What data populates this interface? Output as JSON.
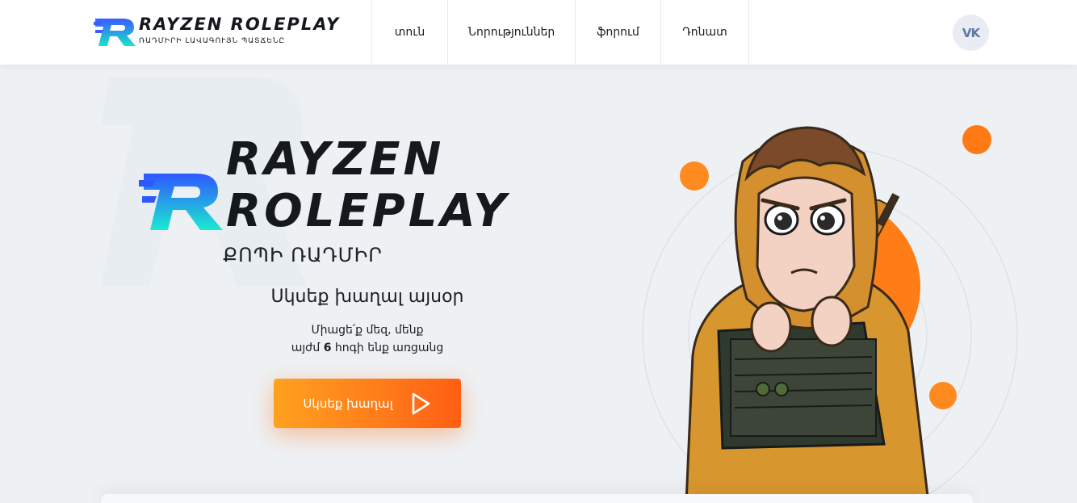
{
  "header": {
    "logo": {
      "title": "RAYZEN ROLEPLAY",
      "subtitle": "ՌԱԴՄԻՐԻ ԼԱՎԱԳՈՒՅՆ ՊԱՏՃԵՆԸ",
      "colors": {
        "gradient_start": "#3b5bff",
        "gradient_end": "#19e3c8"
      }
    },
    "nav": [
      {
        "label": "տուն"
      },
      {
        "label": "Նորություններ"
      },
      {
        "label": "ֆորում"
      },
      {
        "label": "Դոնատ"
      }
    ],
    "social": {
      "label": "VK",
      "icon": "vk-icon"
    }
  },
  "hero": {
    "title_line1": "RAYZEN",
    "title_line2": "ROLEPLAY",
    "subtitle": "ՔՈՊԻ ՌԱԴՄԻՐ",
    "lead": "Սկսեք խաղալ այսօր",
    "text_line1": "Միացե՛ք մեզ, մենք",
    "text_line2_prefix": "այժմ ",
    "text_line2_count": "6",
    "text_line2_suffix": " հոգի ենք առցանց",
    "cta": {
      "label": "Սկսեք խաղալ",
      "icon": "play-icon"
    },
    "accent_color": "#ff7a1a"
  },
  "illustration": {
    "icon": "hooded-character-illustration"
  }
}
